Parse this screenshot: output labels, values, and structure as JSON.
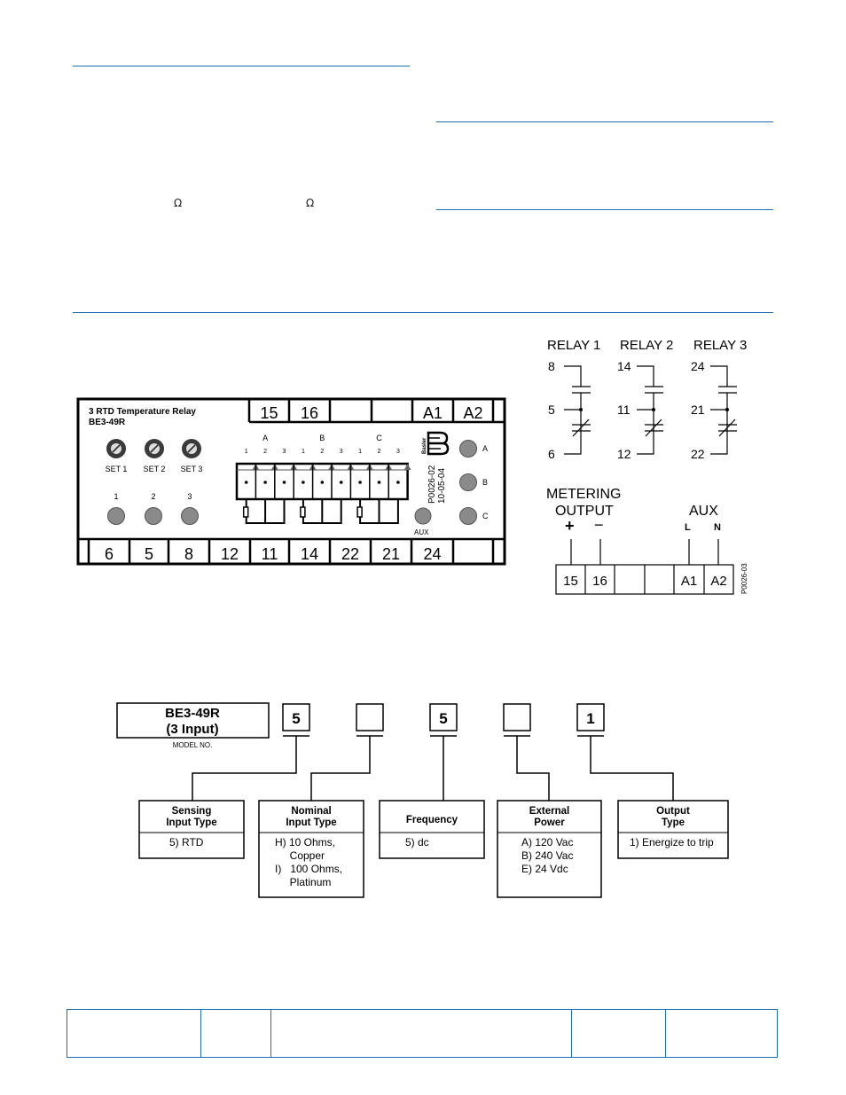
{
  "page": {
    "omega_symbols": [
      "Ω",
      "Ω"
    ],
    "accent_color": "#1a6fb5"
  },
  "front_panel": {
    "title_line1": "3 RTD Temperature Relay",
    "title_line2": "BE3-49R",
    "top_terminals": [
      "15",
      "16",
      "",
      "",
      "A1",
      "A2"
    ],
    "bottom_terminals": [
      "6",
      "5",
      "8",
      "12",
      "11",
      "14",
      "22",
      "21",
      "24",
      ""
    ],
    "setpoint_labels": [
      "SET 1",
      "SET 2",
      "SET 3"
    ],
    "led_labels": [
      "1",
      "2",
      "3"
    ],
    "rtd_groups": [
      "A",
      "B",
      "C"
    ],
    "rtd_pins": [
      "1",
      "2",
      "3"
    ],
    "phase_leds": [
      "A",
      "B",
      "C"
    ],
    "aux_label": "AUX",
    "logo_text": "Basler",
    "drawing_no": "P0026-02",
    "drawing_date": "10-05-04"
  },
  "relay_diagram": {
    "relays": [
      {
        "label": "RELAY 1",
        "no": "8",
        "common": "5",
        "nc": "6"
      },
      {
        "label": "RELAY 2",
        "no": "14",
        "common": "11",
        "nc": "12"
      },
      {
        "label": "RELAY 3",
        "no": "24",
        "common": "21",
        "nc": "22"
      }
    ],
    "metering_label_1": "METERING",
    "metering_label_2": "OUTPUT",
    "plus": "+",
    "minus": "−",
    "aux_label": "AUX",
    "line_label": "L",
    "neutral_label": "N",
    "terminals": [
      "15",
      "16",
      "",
      "",
      "A1",
      "A2"
    ],
    "drawing_no": "P0026-03"
  },
  "style_chart": {
    "model_line1": "BE3-49R",
    "model_line2": "(3 Input)",
    "model_caption": "MODEL NO.",
    "boxes": [
      "5",
      "",
      "5",
      "",
      "1"
    ],
    "categories": [
      {
        "title1": "Sensing",
        "title2": "Input Type",
        "options": [
          "5) RTD"
        ]
      },
      {
        "title1": "Nominal",
        "title2": "Input Type",
        "options": [
          "H) 10 Ohms,",
          "     Copper",
          "I)   100 Ohms,",
          "     Platinum"
        ]
      },
      {
        "title1": "Frequency",
        "title2": "",
        "options": [
          "5) dc"
        ]
      },
      {
        "title1": "External",
        "title2": "Power",
        "options": [
          "A) 120 Vac",
          "B) 240 Vac",
          "E) 24 Vdc"
        ]
      },
      {
        "title1": "Output",
        "title2": "Type",
        "options": [
          "1) Energize to trip"
        ]
      }
    ]
  }
}
